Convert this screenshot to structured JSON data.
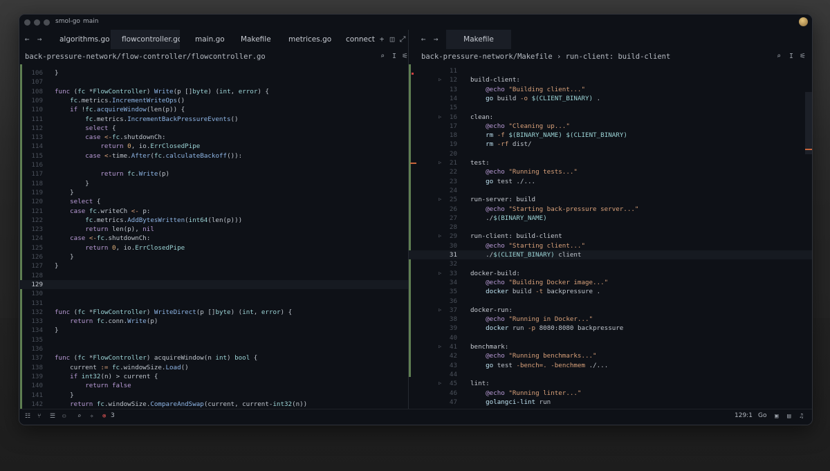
{
  "window": {
    "project": "smol-go",
    "branch": "main"
  },
  "left_tabs": [
    "algorithms.go",
    "flowcontroller.go",
    "main.go",
    "Makefile",
    "metrices.go",
    "connection.go"
  ],
  "left_active_tab": 1,
  "right_tabs": [
    "Makefile"
  ],
  "left_path": "back-pressure-network/flow-controller/flowcontroller.go",
  "right_path": "back-pressure-network/Makefile › run-client: build-client",
  "left_lines": [
    [
      "106",
      "}"
    ],
    [
      "107",
      ""
    ],
    [
      "108",
      "func (fc *FlowController) Write(p []byte) (int, error) {"
    ],
    [
      "109",
      "    fc.metrics.IncrementWriteOps()"
    ],
    [
      "110",
      "    if !fc.acquireWindow(len(p)) {"
    ],
    [
      "111",
      "        fc.metrics.IncrementBackPressureEvents()"
    ],
    [
      "112",
      "        select {"
    ],
    [
      "113",
      "        case <-fc.shutdownCh:"
    ],
    [
      "114",
      "            return 0, io.ErrClosedPipe"
    ],
    [
      "115",
      "        case <-time.After(fc.calculateBackoff()):"
    ],
    [
      "116",
      ""
    ],
    [
      "117",
      "            return fc.Write(p)"
    ],
    [
      "118",
      "        }"
    ],
    [
      "119",
      "    }"
    ],
    [
      "120",
      "    select {"
    ],
    [
      "121",
      "    case fc.writeCh <- p:"
    ],
    [
      "122",
      "        fc.metrics.AddBytesWritten(int64(len(p)))"
    ],
    [
      "123",
      "        return len(p), nil"
    ],
    [
      "124",
      "    case <-fc.shutdownCh:"
    ],
    [
      "125",
      "        return 0, io.ErrClosedPipe"
    ],
    [
      "126",
      "    }"
    ],
    [
      "127",
      "}"
    ],
    [
      "128",
      ""
    ],
    [
      "129",
      ""
    ],
    [
      "130",
      ""
    ],
    [
      "131",
      ""
    ],
    [
      "132",
      "func (fc *FlowController) WriteDirect(p []byte) (int, error) {"
    ],
    [
      "133",
      "    return fc.conn.Write(p)"
    ],
    [
      "134",
      "}"
    ],
    [
      "135",
      ""
    ],
    [
      "136",
      ""
    ],
    [
      "137",
      "func (fc *FlowController) acquireWindow(n int) bool {"
    ],
    [
      "138",
      "    current := fc.windowSize.Load()"
    ],
    [
      "139",
      "    if int32(n) > current {"
    ],
    [
      "140",
      "        return false"
    ],
    [
      "141",
      "    }"
    ],
    [
      "142",
      "    return fc.windowSize.CompareAndSwap(current, current-int32(n))"
    ]
  ],
  "left_current": "129",
  "right_lines": [
    [
      "11",
      ""
    ],
    [
      "12",
      "build-client:"
    ],
    [
      "13",
      "    @echo \"Building client...\""
    ],
    [
      "14",
      "    go build -o $(CLIENT_BINARY) ."
    ],
    [
      "15",
      ""
    ],
    [
      "16",
      "clean:"
    ],
    [
      "17",
      "    @echo \"Cleaning up...\""
    ],
    [
      "18",
      "    rm -f $(BINARY_NAME) $(CLIENT_BINARY)"
    ],
    [
      "19",
      "    rm -rf dist/"
    ],
    [
      "20",
      ""
    ],
    [
      "21",
      "test:"
    ],
    [
      "22",
      "    @echo \"Running tests...\""
    ],
    [
      "23",
      "    go test ./..."
    ],
    [
      "24",
      ""
    ],
    [
      "25",
      "run-server: build"
    ],
    [
      "26",
      "    @echo \"Starting back-pressure server...\""
    ],
    [
      "27",
      "    ./$(BINARY_NAME)"
    ],
    [
      "28",
      ""
    ],
    [
      "29",
      "run-client: build-client"
    ],
    [
      "30",
      "    @echo \"Starting client...\""
    ],
    [
      "31",
      "    ./$(CLIENT_BINARY) client"
    ],
    [
      "32",
      ""
    ],
    [
      "33",
      "docker-build:"
    ],
    [
      "34",
      "    @echo \"Building Docker image...\""
    ],
    [
      "35",
      "    docker build -t backpressure ."
    ],
    [
      "36",
      ""
    ],
    [
      "37",
      "docker-run:"
    ],
    [
      "38",
      "    @echo \"Running in Docker...\""
    ],
    [
      "39",
      "    docker run -p 8080:8080 backpressure"
    ],
    [
      "40",
      ""
    ],
    [
      "41",
      "benchmark:"
    ],
    [
      "42",
      "    @echo \"Running benchmarks...\""
    ],
    [
      "43",
      "    go test -bench=. -benchmem ./..."
    ],
    [
      "44",
      ""
    ],
    [
      "45",
      "lint:"
    ],
    [
      "46",
      "    @echo \"Running linter...\""
    ],
    [
      "47",
      "    golangci-lint run"
    ]
  ],
  "right_current": "31",
  "right_fold_lines": [
    "12",
    "16",
    "21",
    "25",
    "29",
    "33",
    "37",
    "41",
    "45"
  ],
  "status": {
    "errors": "3",
    "cursor": "129:1",
    "language": "Go"
  },
  "colors": {
    "bg": "#0e1117",
    "accent_error": "#e05555",
    "git_added": "#5f7f52"
  }
}
